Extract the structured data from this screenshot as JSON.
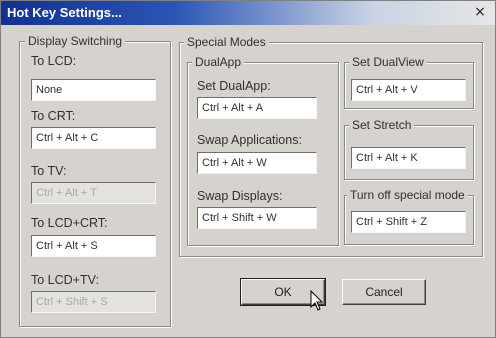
{
  "window": {
    "title": "Hot Key Settings...",
    "close_glyph": "×"
  },
  "display_switching": {
    "legend": "Display Switching",
    "items": [
      {
        "label": "To LCD:",
        "value": "None",
        "enabled": true
      },
      {
        "label": "To CRT:",
        "value": "Ctrl + Alt + C",
        "enabled": true
      },
      {
        "label": "To TV:",
        "value": "Ctrl + Alt + T",
        "enabled": false
      },
      {
        "label": "To LCD+CRT:",
        "value": "Ctrl + Alt + S",
        "enabled": true
      },
      {
        "label": "To LCD+TV:",
        "value": "Ctrl + Shift + S",
        "enabled": false
      }
    ]
  },
  "special_modes": {
    "legend": "Special Modes",
    "dualapp": {
      "legend": "DualApp",
      "items": [
        {
          "label": "Set DualApp:",
          "value": "Ctrl + Alt + A"
        },
        {
          "label": "Swap Applications:",
          "value": "Ctrl + Alt + W"
        },
        {
          "label": "Swap Displays:",
          "value": "Ctrl + Shift + W"
        }
      ]
    },
    "set_dualview": {
      "legend": "Set DualView",
      "value": "Ctrl + Alt + V"
    },
    "set_stretch": {
      "legend": "Set Stretch",
      "value": "Ctrl + Alt + K"
    },
    "turn_off": {
      "legend": "Turn off special mode",
      "value": "Ctrl + Shift + Z"
    }
  },
  "buttons": {
    "ok": "OK",
    "cancel": "Cancel"
  },
  "icons": {
    "cursor": "mouse-pointer-icon"
  }
}
